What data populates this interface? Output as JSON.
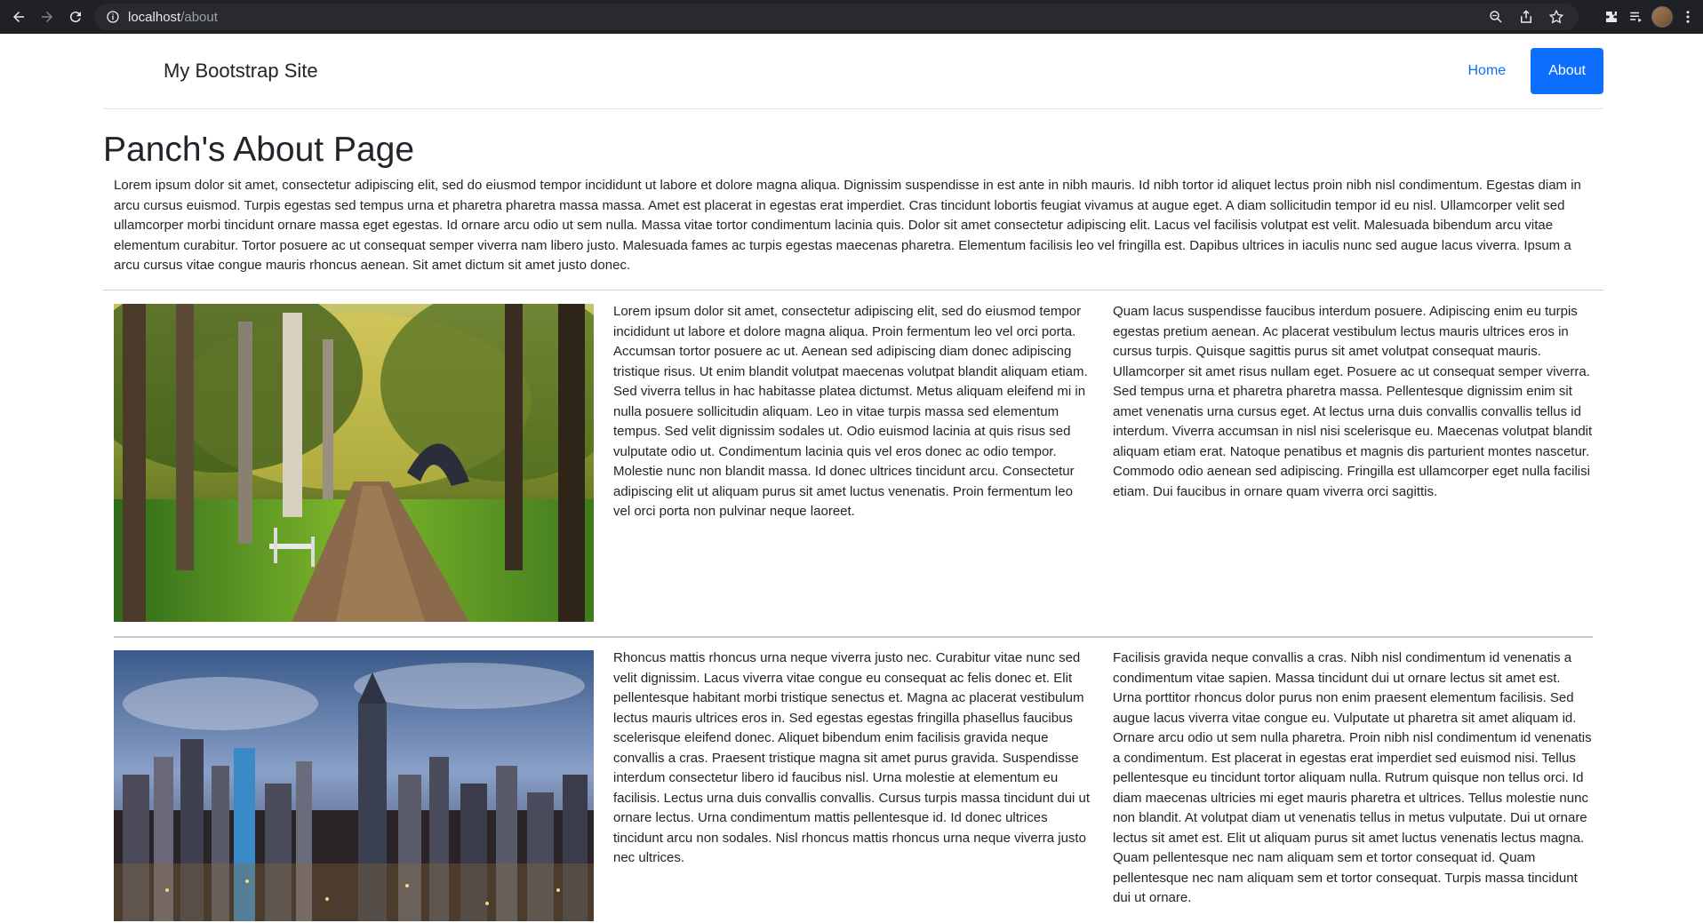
{
  "browser": {
    "url_host": "localhost",
    "url_path": "/about"
  },
  "site": {
    "brand": "My Bootstrap Site",
    "nav": [
      {
        "label": "Home",
        "active": false
      },
      {
        "label": "About",
        "active": true
      }
    ]
  },
  "page": {
    "title": "Panch's About Page",
    "intro": "Lorem ipsum dolor sit amet, consectetur adipiscing elit, sed do eiusmod tempor incididunt ut labore et dolore magna aliqua. Dignissim suspendisse in est ante in nibh mauris. Id nibh tortor id aliquet lectus proin nibh nisl condimentum. Egestas diam in arcu cursus euismod. Turpis egestas sed tempus urna et pharetra pharetra massa massa. Amet est placerat in egestas erat imperdiet. Cras tincidunt lobortis feugiat vivamus at augue eget. A diam sollicitudin tempor id eu nisl. Ullamcorper velit sed ullamcorper morbi tincidunt ornare massa eget egestas. Id ornare arcu odio ut sem nulla. Massa vitae tortor condimentum lacinia quis. Dolor sit amet consectetur adipiscing elit. Lacus vel facilisis volutpat est velit. Malesuada bibendum arcu vitae elementum curabitur. Tortor posuere ac ut consequat semper viverra nam libero justo. Malesuada fames ac turpis egestas maecenas pharetra. Elementum facilisis leo vel fringilla est. Dapibus ultrices in iaculis nunc sed augue lacus viverra. Ipsum a arcu cursus vitae congue mauris rhoncus aenean. Sit amet dictum sit amet justo donec.",
    "rows": [
      {
        "image": "forest-path-image",
        "col1": "Lorem ipsum dolor sit amet, consectetur adipiscing elit, sed do eiusmod tempor incididunt ut labore et dolore magna aliqua. Proin fermentum leo vel orci porta. Accumsan tortor posuere ac ut. Aenean sed adipiscing diam donec adipiscing tristique risus. Ut enim blandit volutpat maecenas volutpat blandit aliquam etiam. Sed viverra tellus in hac habitasse platea dictumst. Metus aliquam eleifend mi in nulla posuere sollicitudin aliquam. Leo in vitae turpis massa sed elementum tempus. Sed velit dignissim sodales ut. Odio euismod lacinia at quis risus sed vulputate odio ut. Condimentum lacinia quis vel eros donec ac odio tempor. Molestie nunc non blandit massa. Id donec ultrices tincidunt arcu. Consectetur adipiscing elit ut aliquam purus sit amet luctus venenatis. Proin fermentum leo vel orci porta non pulvinar neque laoreet.",
        "col2": "Quam lacus suspendisse faucibus interdum posuere. Adipiscing enim eu turpis egestas pretium aenean. Ac placerat vestibulum lectus mauris ultrices eros in cursus turpis. Quisque sagittis purus sit amet volutpat consequat mauris. Ullamcorper sit amet risus nullam eget. Posuere ac ut consequat semper viverra. Sed tempus urna et pharetra pharetra massa. Pellentesque dignissim enim sit amet venenatis urna cursus eget. At lectus urna duis convallis convallis tellus id interdum. Viverra accumsan in nisl nisi scelerisque eu. Maecenas volutpat blandit aliquam etiam erat. Natoque penatibus et magnis dis parturient montes nascetur. Commodo odio aenean sed adipiscing. Fringilla est ullamcorper eget nulla facilisi etiam. Dui faucibus in ornare quam viverra orci sagittis."
      },
      {
        "image": "city-skyline-image",
        "col1": "Rhoncus mattis rhoncus urna neque viverra justo nec. Curabitur vitae nunc sed velit dignissim. Lacus viverra vitae congue eu consequat ac felis donec et. Elit pellentesque habitant morbi tristique senectus et. Magna ac placerat vestibulum lectus mauris ultrices eros in. Sed egestas egestas fringilla phasellus faucibus scelerisque eleifend donec. Aliquet bibendum enim facilisis gravida neque convallis a cras. Praesent tristique magna sit amet purus gravida. Suspendisse interdum consectetur libero id faucibus nisl. Urna molestie at elementum eu facilisis. Lectus urna duis convallis convallis. Cursus turpis massa tincidunt dui ut ornare lectus. Urna condimentum mattis pellentesque id. Id donec ultrices tincidunt arcu non sodales. Nisl rhoncus mattis rhoncus urna neque viverra justo nec ultrices.",
        "col2": "Facilisis gravida neque convallis a cras. Nibh nisl condimentum id venenatis a condimentum vitae sapien. Massa tincidunt dui ut ornare lectus sit amet est. Urna porttitor rhoncus dolor purus non enim praesent elementum facilisis. Sed augue lacus viverra vitae congue eu. Vulputate ut pharetra sit amet aliquam id. Ornare arcu odio ut sem nulla pharetra. Proin nibh nisl condimentum id venenatis a condimentum. Est placerat in egestas erat imperdiet sed euismod nisi. Tellus pellentesque eu tincidunt tortor aliquam nulla. Rutrum quisque non tellus orci. Id diam maecenas ultricies mi eget mauris pharetra et ultrices. Tellus molestie nunc non blandit. At volutpat diam ut venenatis tellus in metus vulputate. Dui ut ornare lectus sit amet est. Elit ut aliquam purus sit amet luctus venenatis lectus magna. Quam pellentesque nec nam aliquam sem et tortor consequat id. Quam pellentesque nec nam aliquam sem et tortor consequat. Turpis massa tincidunt dui ut ornare."
      }
    ]
  },
  "colors": {
    "primary": "#0d6efd",
    "chrome_bg": "#202124",
    "omnibox_bg": "#282a2d",
    "text": "#212529"
  }
}
